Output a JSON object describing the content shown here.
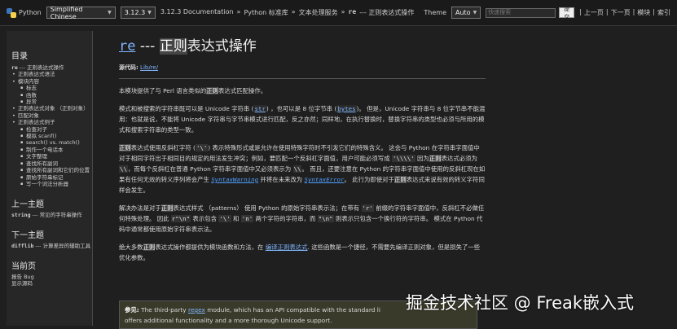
{
  "topbar": {
    "logo_text": "Python",
    "language_select": "Simplified Chinese",
    "version_select": "3.12.3",
    "breadcrumbs": [
      "3.12.3 Documentation",
      "»",
      "Python 标准库",
      "»",
      "文本处理服务",
      "»",
      "re",
      "--- 正则表达式操作"
    ],
    "theme_label": "Theme",
    "theme_select": "Auto",
    "search_placeholder": "快速搜索",
    "search_button": "提交",
    "nav_links": [
      "上一页",
      "下一页",
      "模块",
      "索引"
    ]
  },
  "sidebar": {
    "toc_title": "目录",
    "toc": [
      {
        "level": 0,
        "text": "re --- 正则表达式操作"
      },
      {
        "level": 1,
        "text": "正则表达式语法"
      },
      {
        "level": 1,
        "text": "模块内容"
      },
      {
        "level": 2,
        "text": "标志"
      },
      {
        "level": 2,
        "text": "函数"
      },
      {
        "level": 2,
        "text": "异常"
      },
      {
        "level": 1,
        "text": "正则表达式对象 （正则对象）"
      },
      {
        "level": 1,
        "text": "匹配对象"
      },
      {
        "level": 1,
        "text": "正则表达式例子"
      },
      {
        "level": 2,
        "text": "检查对子"
      },
      {
        "level": 2,
        "text": "模拟 scanf()"
      },
      {
        "level": 2,
        "text": "search() vs. match()"
      },
      {
        "level": 2,
        "text": "制作一个电话本"
      },
      {
        "level": 2,
        "text": "文字整理"
      },
      {
        "level": 2,
        "text": "查找所有副词"
      },
      {
        "level": 2,
        "text": "查找所有副词和它们的位置"
      },
      {
        "level": 2,
        "text": "原始字符串标记"
      },
      {
        "level": 2,
        "text": "写一个词法分析器"
      }
    ],
    "prev_title": "上一主题",
    "prev_code": "string",
    "prev_text": " --- 常见的字符串操作",
    "next_title": "下一主题",
    "next_code": "difflib",
    "next_text": " --- 计算差异的辅助工具",
    "page_title": "当前页",
    "page_links": [
      "报告 Bug",
      "显示源码"
    ]
  },
  "main": {
    "title_module": "re",
    "title_dash": " --- ",
    "title_hl": "正则",
    "title_rest": "表达式操作",
    "source_label": "源代码:",
    "source_link": "Lib/re/",
    "p1": [
      "本模块提供了与 Perl 语言类似的",
      "正则",
      "表达式匹配操作。"
    ],
    "p2": {
      "a": "模式和被搜索的字符串既可以是 Unicode 字符串 (",
      "str": "str",
      "b": ") ，也可以是 8 位字节串 (",
      "bytes": "bytes",
      "c": ")。 但是，Unicode 字符串与 8 位字节串不能混用：也就是说，不能将 Unicode 字符串与字节串模式进行匹配，反之亦然；同样地，在执行替换时，替换字符串的类型也必须与所用的模式和搜索字符串的类型一致。"
    },
    "p3": {
      "hl1": "正则",
      "a": "表达式使用反斜杠字符 (",
      "c1": "'\\'",
      "b": ") 表示特殊形式或是允许在使用特殊字符时不引发它们的特殊含义。 这会与 Python 在字符串字面值中对于相同字符出于相同目的规定的用法发生冲突；例如，要匹配一个反斜杠字面值，用户可能必须写成 ",
      "c2": "'\\\\\\\\'",
      "c": " 因为",
      "hl2": "正则",
      "d": "表达式必须为 ",
      "c3": "\\\\",
      "e": "，而每个反斜杠在普通 Python 字符串字面值中又必须表示为 ",
      "c4": "\\\\",
      "f": "。 而且，还要注意在 Python 的字符串字面值中使用的反斜杠现在如果有任何无效的转义序列将会产生 ",
      "w1": "SyntaxWarning",
      "g": " 并将在未来改为 ",
      "w2": "SyntaxError",
      "h": "。 此行为即使对于",
      "hl3": "正则",
      "i": "表达式来说有效的转义字符同样会发生。"
    },
    "p4": {
      "a": "解决办法是对于",
      "hl1": "正则",
      "b": "表达式样式 （patterns） 使用 Python 的原始字符串表示法；在带有 ",
      "c1": "'r'",
      "c": " 前缀的字符串字面值中，反斜杠不必做任何特殊处理。 因此 ",
      "c2": "r\"\\n\"",
      "d": " 表示包含 ",
      "c3": "'\\'",
      "e": " 和 ",
      "c4": "'n'",
      "f": " 两个字符的字符串，而 ",
      "c5": "\"\\n\"",
      "g": " 则表示只包含一个换行符的字符串。 模式在 Python 代码中通常都使用原始字符串表示法。"
    },
    "p5": {
      "a": "绝大多数",
      "hl1": "正则",
      "b": "表达式操作都提供为模块函数和方法，在 ",
      "link": "编译正则表达式",
      "c": ". 这些函数是一个捷径，不需要先编译正则对象，但是损失了一些优化参数。"
    },
    "seealso": {
      "label": "参见:",
      "a": " The third-party ",
      "link": "regex",
      "b": " module, which has an API compatible with the standard li",
      "c": "offers additional functionality and a more thorough Unicode support."
    }
  },
  "watermark": "掘金技术社区 @ Freak嵌入式"
}
